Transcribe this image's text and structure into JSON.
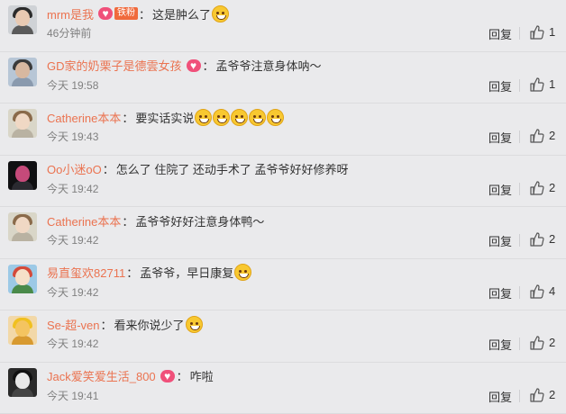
{
  "comments": [
    {
      "user": "mrm是我",
      "badge": true,
      "fan_badge": "铁粉",
      "text": "这是肿么了",
      "emoji_count": 1,
      "time": "46分钟前",
      "reply": "回复",
      "likes": "1",
      "avatar_colors": {
        "bg": "#cfd2d6",
        "hair": "#2b2b2b",
        "face": "#e8c9b2",
        "body": "#5a5a5a"
      }
    },
    {
      "user": "GD家的奶栗子是德雲女孩",
      "badge": true,
      "text": "孟爷爷注意身体呐～",
      "emoji_count": 0,
      "time": "今天 19:58",
      "reply": "回复",
      "likes": "1",
      "avatar_colors": {
        "bg": "#b7c6d6",
        "hair": "#3a3a3a",
        "face": "#d8b8a0",
        "body": "#8a9aae"
      }
    },
    {
      "user": "Catherine本本",
      "badge": false,
      "text": "要实话实说",
      "emoji_count": 5,
      "time": "今天 19:43",
      "reply": "回复",
      "likes": "2",
      "avatar_colors": {
        "bg": "#d9d6c8",
        "hair": "#8a6a4a",
        "face": "#f0d8c4",
        "body": "#b9b2a2"
      }
    },
    {
      "user": "Oo小迷oO",
      "badge": false,
      "text": "怎么了 住院了 还动手术了  孟爷爷好好修养呀",
      "emoji_count": 0,
      "time": "今天 19:42",
      "reply": "回复",
      "likes": "2",
      "avatar_colors": {
        "bg": "#101012",
        "hair": "#101012",
        "face": "#c64a7a",
        "body": "#2a2a30"
      }
    },
    {
      "user": "Catherine本本",
      "badge": false,
      "text": "孟爷爷好好注意身体鸭～",
      "emoji_count": 0,
      "time": "今天 19:42",
      "reply": "回复",
      "likes": "2",
      "avatar_colors": {
        "bg": "#d9d6c8",
        "hair": "#8a6a4a",
        "face": "#f0d8c4",
        "body": "#b9b2a2"
      }
    },
    {
      "user": "易直玺欢82711",
      "badge": false,
      "text": "孟爷爷，早日康复",
      "emoji_count": 1,
      "time": "今天 19:42",
      "reply": "回复",
      "likes": "4",
      "avatar_colors": {
        "bg": "#9cc9e6",
        "hair": "#d44a3a",
        "face": "#f6e0c8",
        "body": "#4a8a4a"
      }
    },
    {
      "user": "Se-超-ven",
      "badge": false,
      "text": "看来你说少了",
      "emoji_count": 1,
      "time": "今天 19:42",
      "reply": "回复",
      "likes": "2",
      "avatar_colors": {
        "bg": "#f2d8a8",
        "hair": "#f0c020",
        "face": "#f4c460",
        "body": "#d89a30"
      }
    },
    {
      "user": "Jack爱笑爱生活_800",
      "badge": true,
      "text": "咋啦",
      "emoji_count": 0,
      "time": "今天 19:41",
      "reply": "回复",
      "likes": "2",
      "avatar_colors": {
        "bg": "#2a2a2a",
        "hair": "#111111",
        "face": "#e8e8e8",
        "body": "#444444"
      }
    }
  ]
}
